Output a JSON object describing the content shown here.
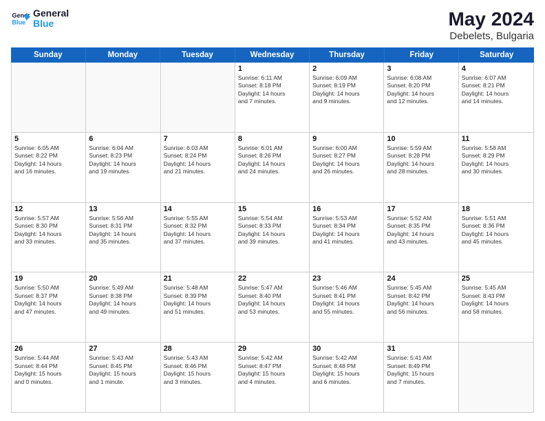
{
  "header": {
    "logo_line1": "General",
    "logo_line2": "Blue",
    "main_title": "May 2024",
    "subtitle": "Debelets, Bulgaria"
  },
  "days_of_week": [
    "Sunday",
    "Monday",
    "Tuesday",
    "Wednesday",
    "Thursday",
    "Friday",
    "Saturday"
  ],
  "rows": [
    [
      {
        "day": "",
        "text": "",
        "empty": true
      },
      {
        "day": "",
        "text": "",
        "empty": true
      },
      {
        "day": "",
        "text": "",
        "empty": true
      },
      {
        "day": "1",
        "text": "Sunrise: 6:11 AM\nSunset: 8:18 PM\nDaylight: 14 hours\nand 7 minutes."
      },
      {
        "day": "2",
        "text": "Sunrise: 6:09 AM\nSunset: 8:19 PM\nDaylight: 14 hours\nand 9 minutes."
      },
      {
        "day": "3",
        "text": "Sunrise: 6:08 AM\nSunset: 8:20 PM\nDaylight: 14 hours\nand 12 minutes."
      },
      {
        "day": "4",
        "text": "Sunrise: 6:07 AM\nSunset: 8:21 PM\nDaylight: 14 hours\nand 14 minutes."
      }
    ],
    [
      {
        "day": "5",
        "text": "Sunrise: 6:05 AM\nSunset: 8:22 PM\nDaylight: 14 hours\nand 16 minutes."
      },
      {
        "day": "6",
        "text": "Sunrise: 6:04 AM\nSunset: 8:23 PM\nDaylight: 14 hours\nand 19 minutes."
      },
      {
        "day": "7",
        "text": "Sunrise: 6:03 AM\nSunset: 8:24 PM\nDaylight: 14 hours\nand 21 minutes."
      },
      {
        "day": "8",
        "text": "Sunrise: 6:01 AM\nSunset: 8:26 PM\nDaylight: 14 hours\nand 24 minutes."
      },
      {
        "day": "9",
        "text": "Sunrise: 6:00 AM\nSunset: 8:27 PM\nDaylight: 14 hours\nand 26 minutes."
      },
      {
        "day": "10",
        "text": "Sunrise: 5:59 AM\nSunset: 8:28 PM\nDaylight: 14 hours\nand 28 minutes."
      },
      {
        "day": "11",
        "text": "Sunrise: 5:58 AM\nSunset: 8:29 PM\nDaylight: 14 hours\nand 30 minutes."
      }
    ],
    [
      {
        "day": "12",
        "text": "Sunrise: 5:57 AM\nSunset: 8:30 PM\nDaylight: 14 hours\nand 33 minutes."
      },
      {
        "day": "13",
        "text": "Sunrise: 5:56 AM\nSunset: 8:31 PM\nDaylight: 14 hours\nand 35 minutes."
      },
      {
        "day": "14",
        "text": "Sunrise: 5:55 AM\nSunset: 8:32 PM\nDaylight: 14 hours\nand 37 minutes."
      },
      {
        "day": "15",
        "text": "Sunrise: 5:54 AM\nSunset: 8:33 PM\nDaylight: 14 hours\nand 39 minutes."
      },
      {
        "day": "16",
        "text": "Sunrise: 5:53 AM\nSunset: 8:34 PM\nDaylight: 14 hours\nand 41 minutes."
      },
      {
        "day": "17",
        "text": "Sunrise: 5:52 AM\nSunset: 8:35 PM\nDaylight: 14 hours\nand 43 minutes."
      },
      {
        "day": "18",
        "text": "Sunrise: 5:51 AM\nSunset: 8:36 PM\nDaylight: 14 hours\nand 45 minutes."
      }
    ],
    [
      {
        "day": "19",
        "text": "Sunrise: 5:50 AM\nSunset: 8:37 PM\nDaylight: 14 hours\nand 47 minutes."
      },
      {
        "day": "20",
        "text": "Sunrise: 5:49 AM\nSunset: 8:38 PM\nDaylight: 14 hours\nand 49 minutes."
      },
      {
        "day": "21",
        "text": "Sunrise: 5:48 AM\nSunset: 8:39 PM\nDaylight: 14 hours\nand 51 minutes."
      },
      {
        "day": "22",
        "text": "Sunrise: 5:47 AM\nSunset: 8:40 PM\nDaylight: 14 hours\nand 53 minutes."
      },
      {
        "day": "23",
        "text": "Sunrise: 5:46 AM\nSunset: 8:41 PM\nDaylight: 14 hours\nand 55 minutes."
      },
      {
        "day": "24",
        "text": "Sunrise: 5:45 AM\nSunset: 8:42 PM\nDaylight: 14 hours\nand 56 minutes."
      },
      {
        "day": "25",
        "text": "Sunrise: 5:45 AM\nSunset: 8:43 PM\nDaylight: 14 hours\nand 58 minutes."
      }
    ],
    [
      {
        "day": "26",
        "text": "Sunrise: 5:44 AM\nSunset: 8:44 PM\nDaylight: 15 hours\nand 0 minutes."
      },
      {
        "day": "27",
        "text": "Sunrise: 5:43 AM\nSunset: 8:45 PM\nDaylight: 15 hours\nand 1 minute."
      },
      {
        "day": "28",
        "text": "Sunrise: 5:43 AM\nSunset: 8:46 PM\nDaylight: 15 hours\nand 3 minutes."
      },
      {
        "day": "29",
        "text": "Sunrise: 5:42 AM\nSunset: 8:47 PM\nDaylight: 15 hours\nand 4 minutes."
      },
      {
        "day": "30",
        "text": "Sunrise: 5:42 AM\nSunset: 8:48 PM\nDaylight: 15 hours\nand 6 minutes."
      },
      {
        "day": "31",
        "text": "Sunrise: 5:41 AM\nSunset: 8:49 PM\nDaylight: 15 hours\nand 7 minutes."
      },
      {
        "day": "",
        "text": "",
        "empty": true
      }
    ]
  ]
}
